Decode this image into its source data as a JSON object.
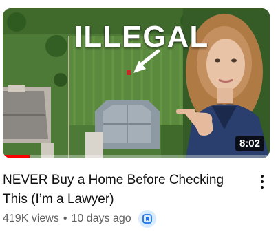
{
  "video": {
    "thumbnail": {
      "overlay_text": "ILLEGAL",
      "duration": "8:02",
      "progress_fraction": 0.1
    },
    "title": "NEVER Buy a Home Before Checking This (I’m a Lawyer)",
    "views": "419K views",
    "separator": "•",
    "age": "10 days ago",
    "more_icon": "vertical-ellipsis-icon",
    "badge_icon": "bookmark-icon"
  },
  "colors": {
    "title": "#0f0f0f",
    "meta": "#606060",
    "progress": "#ff0000",
    "badge_bg": "#d9ecff",
    "badge_icon": "#1a73e8"
  }
}
